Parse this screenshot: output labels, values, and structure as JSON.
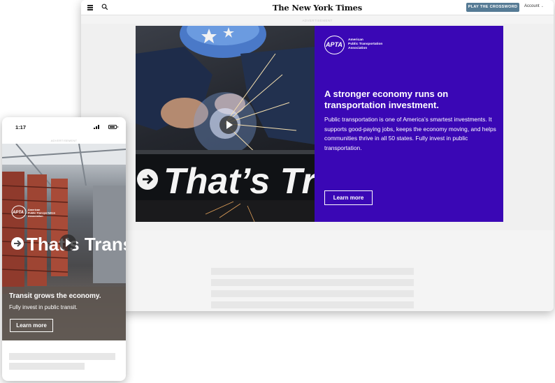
{
  "desktop": {
    "logo": "The New York Times",
    "crossword_button": "PLAY THE CROSSWORD",
    "account_label": "Account",
    "ad_label": "ADVERTISEMENT",
    "ad": {
      "photo_text": "That’s Tra",
      "sponsor_mark": "APTA",
      "sponsor_name": "American\nPublic Transportation\nAssociation",
      "headline": "A stronger economy runs on transportation investment.",
      "body": "Public transportation is one of America’s smartest investments. It supports good-paying jobs, keeps the economy moving, and helps communities thrive in all 50 states. Fully invest in public transportation.",
      "cta": "Learn more",
      "panel_color": "#3a07b5"
    },
    "header_icons": [
      "menu-icon",
      "search-icon"
    ]
  },
  "mobile": {
    "time": "1:17",
    "ad_label": "ADVERTISEMENT",
    "ad": {
      "sponsor_mark": "APTA",
      "sponsor_name": "American\nPublic Transportation\nAssociation",
      "photo_text": "That’s Transit",
      "headline": "Transit grows the economy.",
      "subhead": "Fully invest in public transit.",
      "cta": "Learn more"
    }
  },
  "colors": {
    "crossword_button": "#567b95",
    "ad_panel": "#3a07b5"
  }
}
